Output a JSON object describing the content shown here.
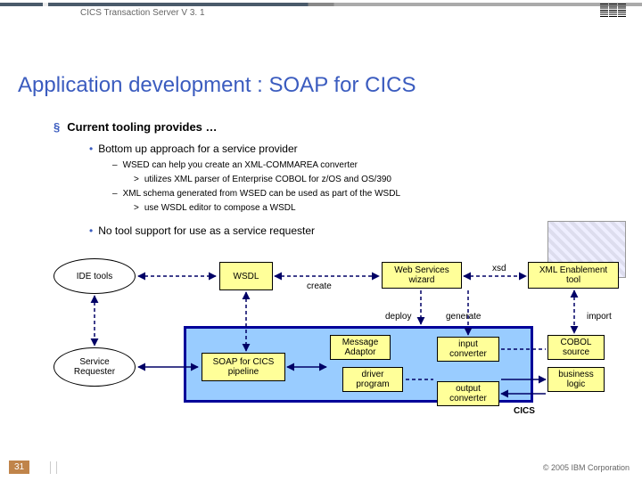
{
  "header": {
    "title": "CICS Transaction Server V 3. 1",
    "logo": "IBM"
  },
  "slide": {
    "title": "Application development : SOAP for CICS",
    "bullet1": "Current tooling provides …",
    "bullet2a": "Bottom up approach for a service provider",
    "bullet3a": "WSED can help you create an XML-COMMAREA converter",
    "bullet4a": "utilizes XML parser of Enterprise COBOL for z/OS and OS/390",
    "bullet3b": "XML schema generated from WSED can be used as part of the WSDL",
    "bullet4b": "use WSDL editor to compose a WSDL",
    "bullet2b": "No tool support for use as a service requester"
  },
  "diagram": {
    "ide_tools": "IDE tools",
    "service_requester": "Service\nRequester",
    "wsdl": "WSDL",
    "soap_pipeline": "SOAP for CICS\npipeline",
    "web_services_wizard": "Web Services\nwizard",
    "xml_tool": "XML Enablement\ntool",
    "message_adaptor": "Message\nAdaptor",
    "driver_program": "driver\nprogram",
    "input_converter": "input\nconverter",
    "output_converter": "output\nconverter",
    "cobol_source": "COBOL\nsource",
    "business_logic": "business\nlogic",
    "labels": {
      "create": "create",
      "deploy": "deploy",
      "xsd": "xsd",
      "generate": "generate",
      "import": "import",
      "cics": "CICS"
    }
  },
  "footer": {
    "page": "31",
    "copyright": "© 2005 IBM Corporation"
  }
}
